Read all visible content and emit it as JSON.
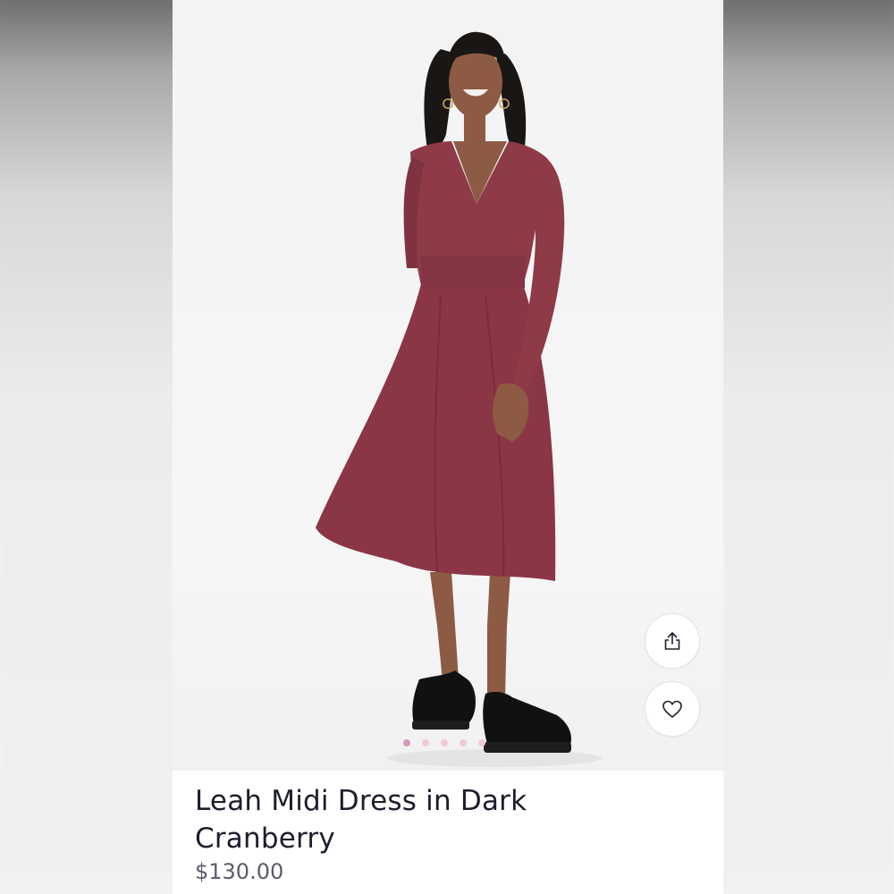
{
  "product": {
    "title": "Leah Midi Dress in Dark Cranberry",
    "price": "$130.00"
  },
  "gallery": {
    "image_count": 5,
    "active_index": 0
  },
  "actions": {
    "share_icon": "share-icon",
    "favorite_icon": "heart-icon"
  },
  "colors": {
    "dress": "#8e3a47",
    "dot_active": "#d897bb",
    "dot_inactive": "#efc8dc",
    "title_text": "#1c1e2e",
    "price_text": "#5a5c6c"
  }
}
